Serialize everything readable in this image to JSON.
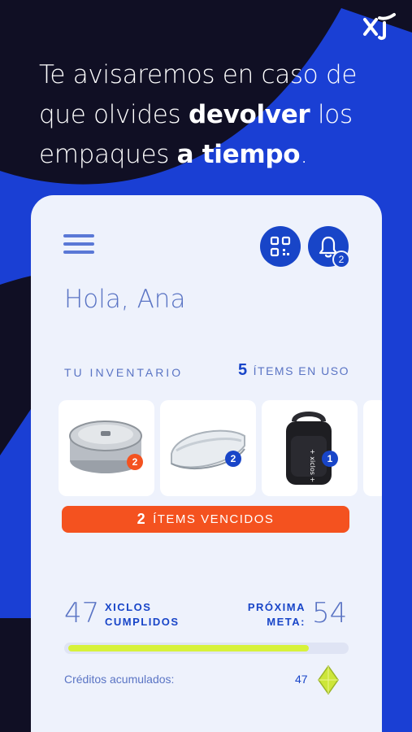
{
  "promo": {
    "line1": "Te avisaremos en caso de",
    "line2_pre": "que olvides ",
    "line2_bold": "devolver",
    "line2_post": " los",
    "line3_pre": "empaques ",
    "line3_bold": "a tiempo",
    "line3_post": "."
  },
  "header": {
    "notification_count": "2"
  },
  "greeting": "Hola, Ana",
  "inventory": {
    "label": "TU INVENTARIO",
    "count": "5",
    "count_label": "ÍTEMS EN USO",
    "items": [
      {
        "name": "steel-container",
        "badge": "2",
        "badge_color": "#f4521f"
      },
      {
        "name": "transparent-container",
        "badge": "2",
        "badge_color": "#1845c8"
      },
      {
        "name": "backpack",
        "badge": "1",
        "badge_color": "#1845c8",
        "print": "+ xiclos + xi"
      }
    ]
  },
  "expired": {
    "count": "2",
    "label": "ÍTEMS VENCIDOS",
    "color": "#f4521f"
  },
  "stats": {
    "cycles_value": "47",
    "cycles_label_1": "XICLOS",
    "cycles_label_2": "CUMPLIDOS",
    "goal_label_1": "PRÓXIMA",
    "goal_label_2": "META:",
    "goal_value": "54",
    "progress": 0.87
  },
  "credits": {
    "label": "Créditos acumulados:",
    "value": "47"
  },
  "colors": {
    "background": "#100f24",
    "accent": "#1845c8",
    "alert": "#f4521f",
    "progress": "#d7f23a"
  }
}
